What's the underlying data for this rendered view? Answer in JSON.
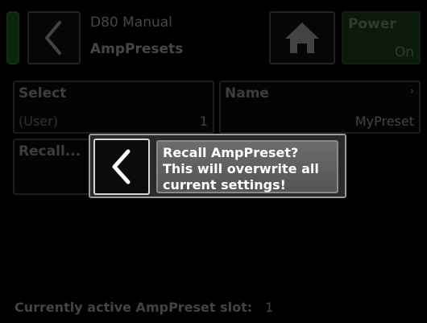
{
  "header": {
    "title": "D80 Manual",
    "subtitle": "AmpPresets",
    "power_label": "Power",
    "power_value": "On"
  },
  "select_cell": {
    "label": "Select",
    "left_value": "(User)",
    "right_value": "1"
  },
  "name_cell": {
    "label": "Name",
    "value": "MyPreset",
    "chevron": "›"
  },
  "recall_cell": {
    "label": "Recall..."
  },
  "status": {
    "label": "Currently active AmpPreset slot:",
    "slot": "1"
  },
  "dialog": {
    "lines": [
      "Recall AmpPreset?",
      "This will overwrite all",
      "current settings!"
    ]
  },
  "colors": {
    "indicator": "#1f7a22",
    "power_bg": "#26511f",
    "dialog_bg": "#2a2a2a"
  },
  "icons": {
    "back": "chevron-left-icon",
    "home": "home-icon"
  }
}
